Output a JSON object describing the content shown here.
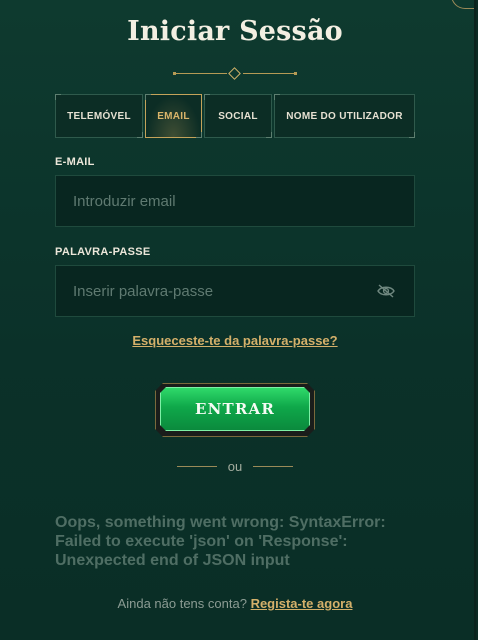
{
  "title": "Iniciar Sessão",
  "tabs": [
    {
      "label": "TELEMÓVEL",
      "active": false
    },
    {
      "label": "EMAIL",
      "active": true
    },
    {
      "label": "SOCIAL",
      "active": false
    },
    {
      "label": "NOME DO UTILIZADOR",
      "active": false
    }
  ],
  "email_field": {
    "label": "E-MAIL",
    "placeholder": "Introduzir email",
    "value": ""
  },
  "password_field": {
    "label": "PALAVRA-PASSE",
    "placeholder": "Inserir palavra-passe",
    "value": "",
    "toggle_icon": "eye-slash-icon"
  },
  "forgot_link": "Esqueceste-te da palavra-passe?",
  "submit_label": "ENTRAR",
  "or_label": "ou",
  "error_message": "Oops, something went wrong: SyntaxError: Failed to execute 'json' on 'Response': Unexpected end of JSON input",
  "signup": {
    "prompt": "Ainda não tens conta?",
    "link": "Regista-te agora"
  },
  "colors": {
    "accent_gold": "#d4b06a",
    "button_green": "#0fa84a",
    "panel_bg": "#0e3a2f"
  }
}
